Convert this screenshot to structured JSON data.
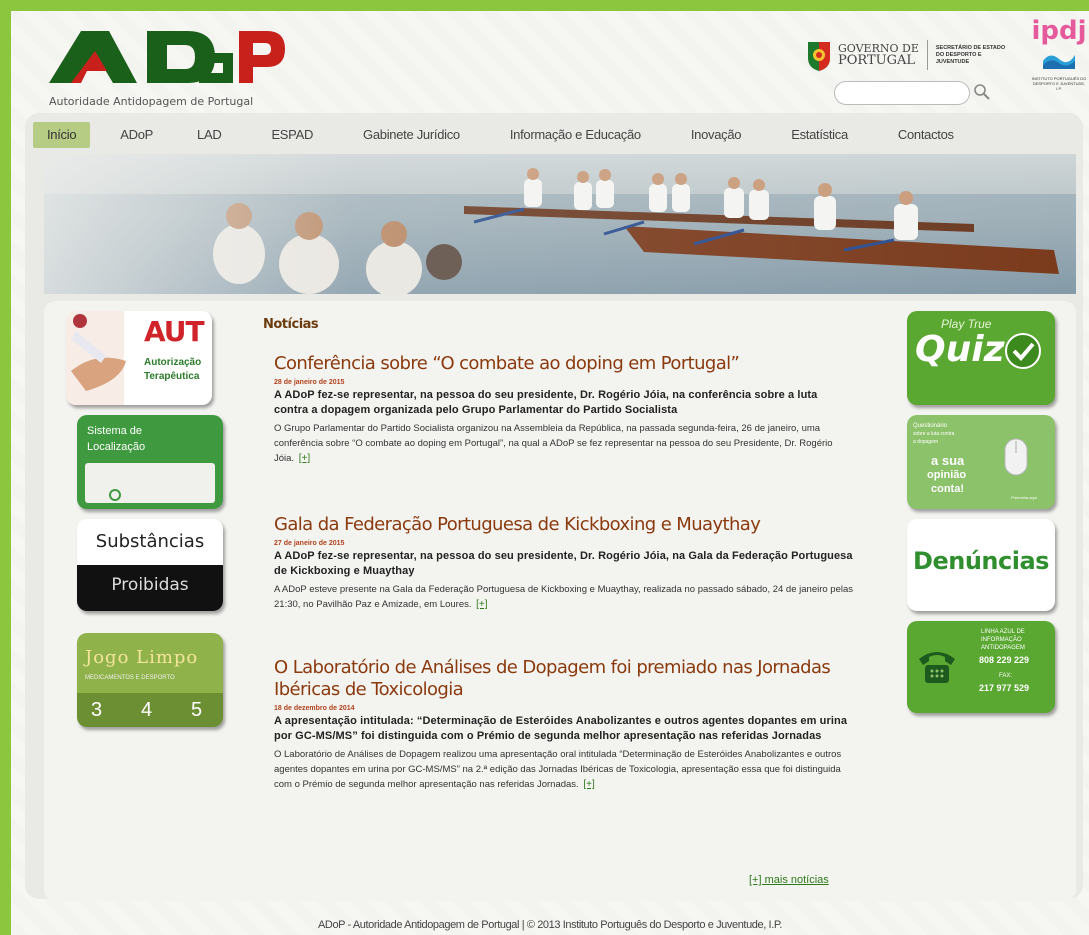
{
  "header": {
    "logo_text": "ADoP",
    "logo_subtitle": "Autoridade Antidopagem de Portugal",
    "gov_line1": "GOVERNO DE",
    "gov_line2": "PORTUGAL",
    "gov_secretary": "SECRETÁRIO DE ESTADO DO DESPORTO E JUVENTUDE",
    "ipdj_mark": "ipdj",
    "ipdj_sub": "INSTITUTO PORTUGUÊS DO DESPORTO E JUVENTUDE, I.P.",
    "search_placeholder": ""
  },
  "nav": {
    "items": [
      {
        "label": "Início",
        "active": true
      },
      {
        "label": "ADoP"
      },
      {
        "label": "LAD"
      },
      {
        "label": "ESPAD"
      },
      {
        "label": "Gabinete Jurídico"
      },
      {
        "label": "Informação e Educação"
      },
      {
        "label": "Inovação"
      },
      {
        "label": "Estatística"
      },
      {
        "label": "Contactos"
      }
    ]
  },
  "left_sidebar": {
    "aut": {
      "big": "AUT",
      "line1": "Autorização",
      "line2": "Terapêutica"
    },
    "localizacao": {
      "line1": "Sistema de",
      "line2": "Localização"
    },
    "substancias": {
      "top": "Substâncias",
      "bottom": "Proibidas"
    },
    "jogo_limpo": {
      "title": "Jogo Limpo",
      "sub": "MEDICAMENTOS E DESPORTO",
      "n1": "3",
      "n2": "4",
      "n3": "5"
    }
  },
  "right_sidebar": {
    "quiz": {
      "small": "Play True",
      "big": "Quiz"
    },
    "questionario": {
      "line1": "Questionário",
      "line2": "sobre a luta contra",
      "line3": "a dopagem",
      "line4": "a sua",
      "line5": "opinião",
      "line6": "conta!",
      "note": "Preencha aqui"
    },
    "denuncias": {
      "label": "Denúncias"
    },
    "linha_azul": {
      "line1": "LINHA AZUL DE",
      "line2": "INFORMAÇÃO",
      "line3": "ANTIDOPAGEM",
      "phone": "808 229 229",
      "fax_label": "FAX:",
      "fax": "217 977 529"
    }
  },
  "news": {
    "heading": "Notícias",
    "articles": [
      {
        "title": "Conferência sobre “O combate ao doping em Portugal”",
        "date": "28 de janeiro de 2015",
        "lead": "A ADoP fez-se representar, na pessoa do seu presidente, Dr. Rogério Jóia, na conferência sobre a luta contra a dopagem organizada pelo Grupo Parlamentar do Partido Socialista",
        "body": "O Grupo Parlamentar do Partido Socialista organizou na Assembleia da República, na passada segunda-feira, 26 de janeiro, uma conferência sobre “O combate ao doping em Portugal”, na qual a ADoP se fez representar na pessoa do seu Presidente, Dr. Rogério Jóia.",
        "more": "[+]"
      },
      {
        "title": "Gala da Federação Portuguesa de Kickboxing e Muaythay",
        "date": "27 de janeiro de 2015",
        "lead": "A ADoP fez-se representar, na pessoa do seu presidente, Dr. Rogério Jóia, na Gala da Federação Portuguesa de Kickboxing e Muaythay",
        "body": "A ADoP esteve presente na Gala da Federação Portuguesa de Kickboxing e Muaythay, realizada no passado sábado, 24 de janeiro pelas 21:30, no Pavilhão Paz e Amizade, em Loures.",
        "more": "[+]"
      },
      {
        "title": "O Laboratório de Análises de Dopagem foi premiado nas Jornadas Ibéricas de Toxicologia",
        "date": "18 de dezembro de 2014",
        "lead": "A apresentação intitulada: “Determinação de Esteróides Anabolizantes e outros agentes dopantes em urina por GC-MS/MS” foi distinguida com o Prémio de segunda melhor apresentação nas referidas Jornadas",
        "body": "O Laboratório de Análises de Dopagem realizou uma apresentação oral intitulada “Determinação de Esteróides Anabolizantes e outros agentes dopantes em urina por GC-MS/MS” na 2.ª edição das Jornadas Ibéricas de Toxicologia, apresentação essa que foi distinguida com o Prémio de segunda melhor apresentação nas referidas Jornadas.",
        "more": "[+]"
      }
    ],
    "more_news": "[+] mais notícias"
  },
  "footer": {
    "text": "ADoP - Autoridade Antidopagem de Portugal | © 2013 Instituto Português do Desporto e Juventude, I.P."
  },
  "colors": {
    "page_border": "#8cc63f",
    "nav_active": "#b6cc84",
    "title_brown": "#8b3a0e",
    "link_green": "#2e7a19",
    "logo_green": "#1a5f1a",
    "logo_red": "#c8211b"
  }
}
